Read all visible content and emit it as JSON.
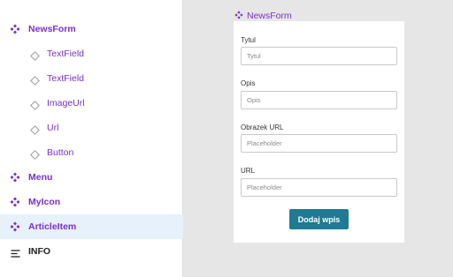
{
  "layers": {
    "items": [
      {
        "label": "NewsForm",
        "type": "component"
      },
      {
        "label": "TextField",
        "type": "instance"
      },
      {
        "label": "TextField",
        "type": "instance"
      },
      {
        "label": "ImageUrl",
        "type": "instance"
      },
      {
        "label": "Url",
        "type": "instance"
      },
      {
        "label": "Button",
        "type": "instance"
      },
      {
        "label": "Menu",
        "type": "component"
      },
      {
        "label": "MyIcon",
        "type": "component"
      },
      {
        "label": "ArticleItem",
        "type": "component",
        "selected": true
      },
      {
        "label": "INFO",
        "type": "text-layer"
      }
    ]
  },
  "canvas": {
    "frame_name": "NewsForm",
    "fields": [
      {
        "label": "Tytul",
        "placeholder": "Tytul"
      },
      {
        "label": "Opis",
        "placeholder": "Opis"
      },
      {
        "label": "Obrazek URL",
        "placeholder": "Placeholder"
      },
      {
        "label": "URL",
        "placeholder": "Placeholder"
      }
    ],
    "submit_label": "Dodaj wpis"
  },
  "colors": {
    "component_purple": "#7b2fc9",
    "selected_row": "#e6f1fc",
    "button_teal": "#1f7a94",
    "canvas_bg": "#e6e6e6"
  }
}
